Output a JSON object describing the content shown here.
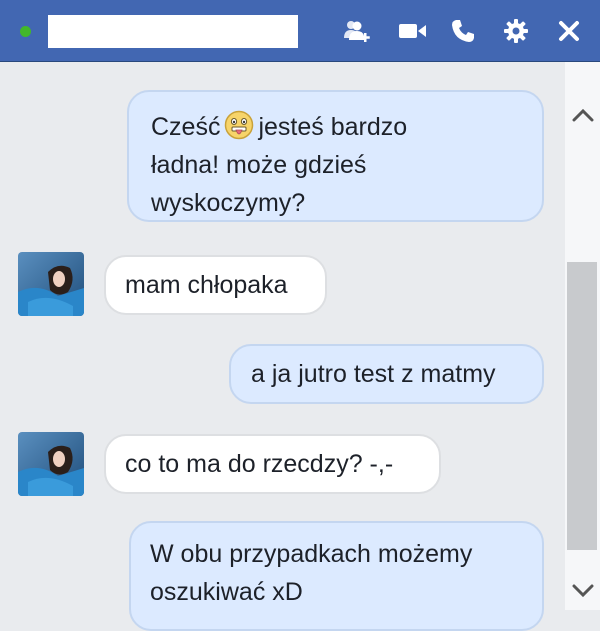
{
  "header": {
    "status_color": "#42b72a",
    "icons": [
      "add-friend-icon",
      "video-call-icon",
      "phone-icon",
      "gear-icon",
      "close-icon"
    ]
  },
  "messages": [
    {
      "from": "me",
      "text_before": "Cześć",
      "emoji": "face-with-tongue",
      "text_after": "jesteś bardzo",
      "line2": "ładna! może gdzieś",
      "line3": "wyskoczymy?"
    },
    {
      "from": "contact",
      "text": "mam chłopaka"
    },
    {
      "from": "me",
      "text": "a ja jutro test z matmy"
    },
    {
      "from": "contact",
      "text": "co to ma do rzecdzy? -,-"
    },
    {
      "from": "me",
      "line1": "W obu przypadkach możemy",
      "line2": "oszukiwać xD"
    }
  ],
  "colors": {
    "header": "#4267b2",
    "outgoing_bubble": "#dceaff",
    "incoming_bubble": "#ffffff",
    "background": "#e9ebee"
  }
}
